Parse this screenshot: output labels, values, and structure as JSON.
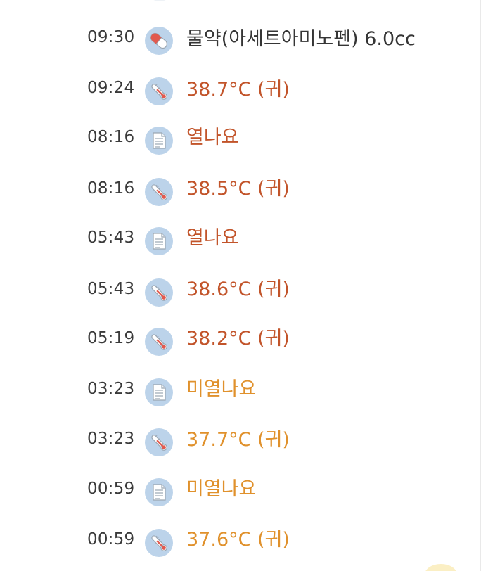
{
  "colors": {
    "icon_bg": "#bcd3ea",
    "text_default": "#353535",
    "text_fever": "#c2542a",
    "text_low_fever": "#e0912c"
  },
  "entries": [
    {
      "time": "09:30",
      "icon": "pill-icon",
      "text": "물약(아세트아미노펜) 6.0cc",
      "tone": "medication"
    },
    {
      "time": "09:24",
      "icon": "thermometer-icon",
      "text": "38.7°C (귀)",
      "tone": "fever"
    },
    {
      "time": "08:16",
      "icon": "memo-icon",
      "text": "열나요",
      "tone": "fever"
    },
    {
      "time": "08:16",
      "icon": "thermometer-icon",
      "text": "38.5°C (귀)",
      "tone": "fever"
    },
    {
      "time": "05:43",
      "icon": "memo-icon",
      "text": "열나요",
      "tone": "fever"
    },
    {
      "time": "05:43",
      "icon": "thermometer-icon",
      "text": "38.6°C (귀)",
      "tone": "fever"
    },
    {
      "time": "05:19",
      "icon": "thermometer-icon",
      "text": "38.2°C (귀)",
      "tone": "fever"
    },
    {
      "time": "03:23",
      "icon": "memo-icon",
      "text": "미열나요",
      "tone": "low-fever"
    },
    {
      "time": "03:23",
      "icon": "thermometer-icon",
      "text": "37.7°C (귀)",
      "tone": "low-fever"
    },
    {
      "time": "00:59",
      "icon": "memo-icon",
      "text": "미열나요",
      "tone": "low-fever"
    },
    {
      "time": "00:59",
      "icon": "thermometer-icon",
      "text": "37.6°C (귀)",
      "tone": "low-fever"
    }
  ]
}
